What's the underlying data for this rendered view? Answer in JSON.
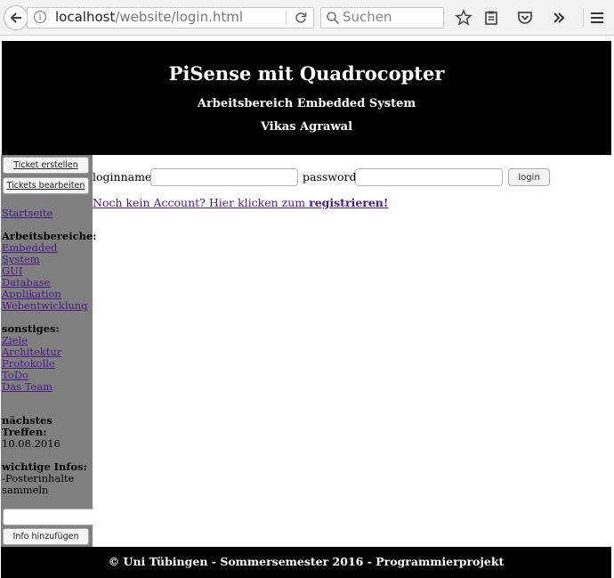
{
  "browser": {
    "url_host": "localhost",
    "url_path": "/website/login.html",
    "search_placeholder": "Suchen"
  },
  "header": {
    "title": "PiSense mit Quadrocopter",
    "subtitle": "Arbeitsbereich Embedded System",
    "author": "Vikas Agrawal"
  },
  "sidebar": {
    "ticket_create_label": "Ticket erstellen",
    "ticket_edit_label": "Tickets bearbeiten",
    "home_link": "Startseite",
    "areas_heading": "Arbeitsbereiche:",
    "areas": [
      "Embedded",
      "System",
      "GUI",
      "Database",
      "Applikation",
      "Webentwicklung"
    ],
    "other_heading": "sonstiges:",
    "other": [
      "Ziele",
      "Architektur",
      "Protokolle",
      "ToDo",
      "Das Team"
    ],
    "meeting_heading_1": "nächstes",
    "meeting_heading_2": "Treffen:",
    "meeting_date": "10.08.2016",
    "info_heading": "wichtige Infos:",
    "info_line_1": "-Posterinhalte",
    "info_line_2": "sammeln",
    "info_input_value": "",
    "add_info_label": "Info hinzufügen"
  },
  "login": {
    "loginname_label": "loginname",
    "loginname_value": "",
    "password_label": "password",
    "password_value": "",
    "login_button": "login",
    "register_prefix": "Noch kein Account? Hier klicken zum ",
    "register_link": "registrieren!"
  },
  "footer": {
    "text": "© Uni Tübingen - Sommersemester 2016 - Programmierprojekt"
  },
  "colors": {
    "header_bg": "#000000",
    "sidebar_bg": "#808080",
    "link": "#4a1a8a"
  }
}
